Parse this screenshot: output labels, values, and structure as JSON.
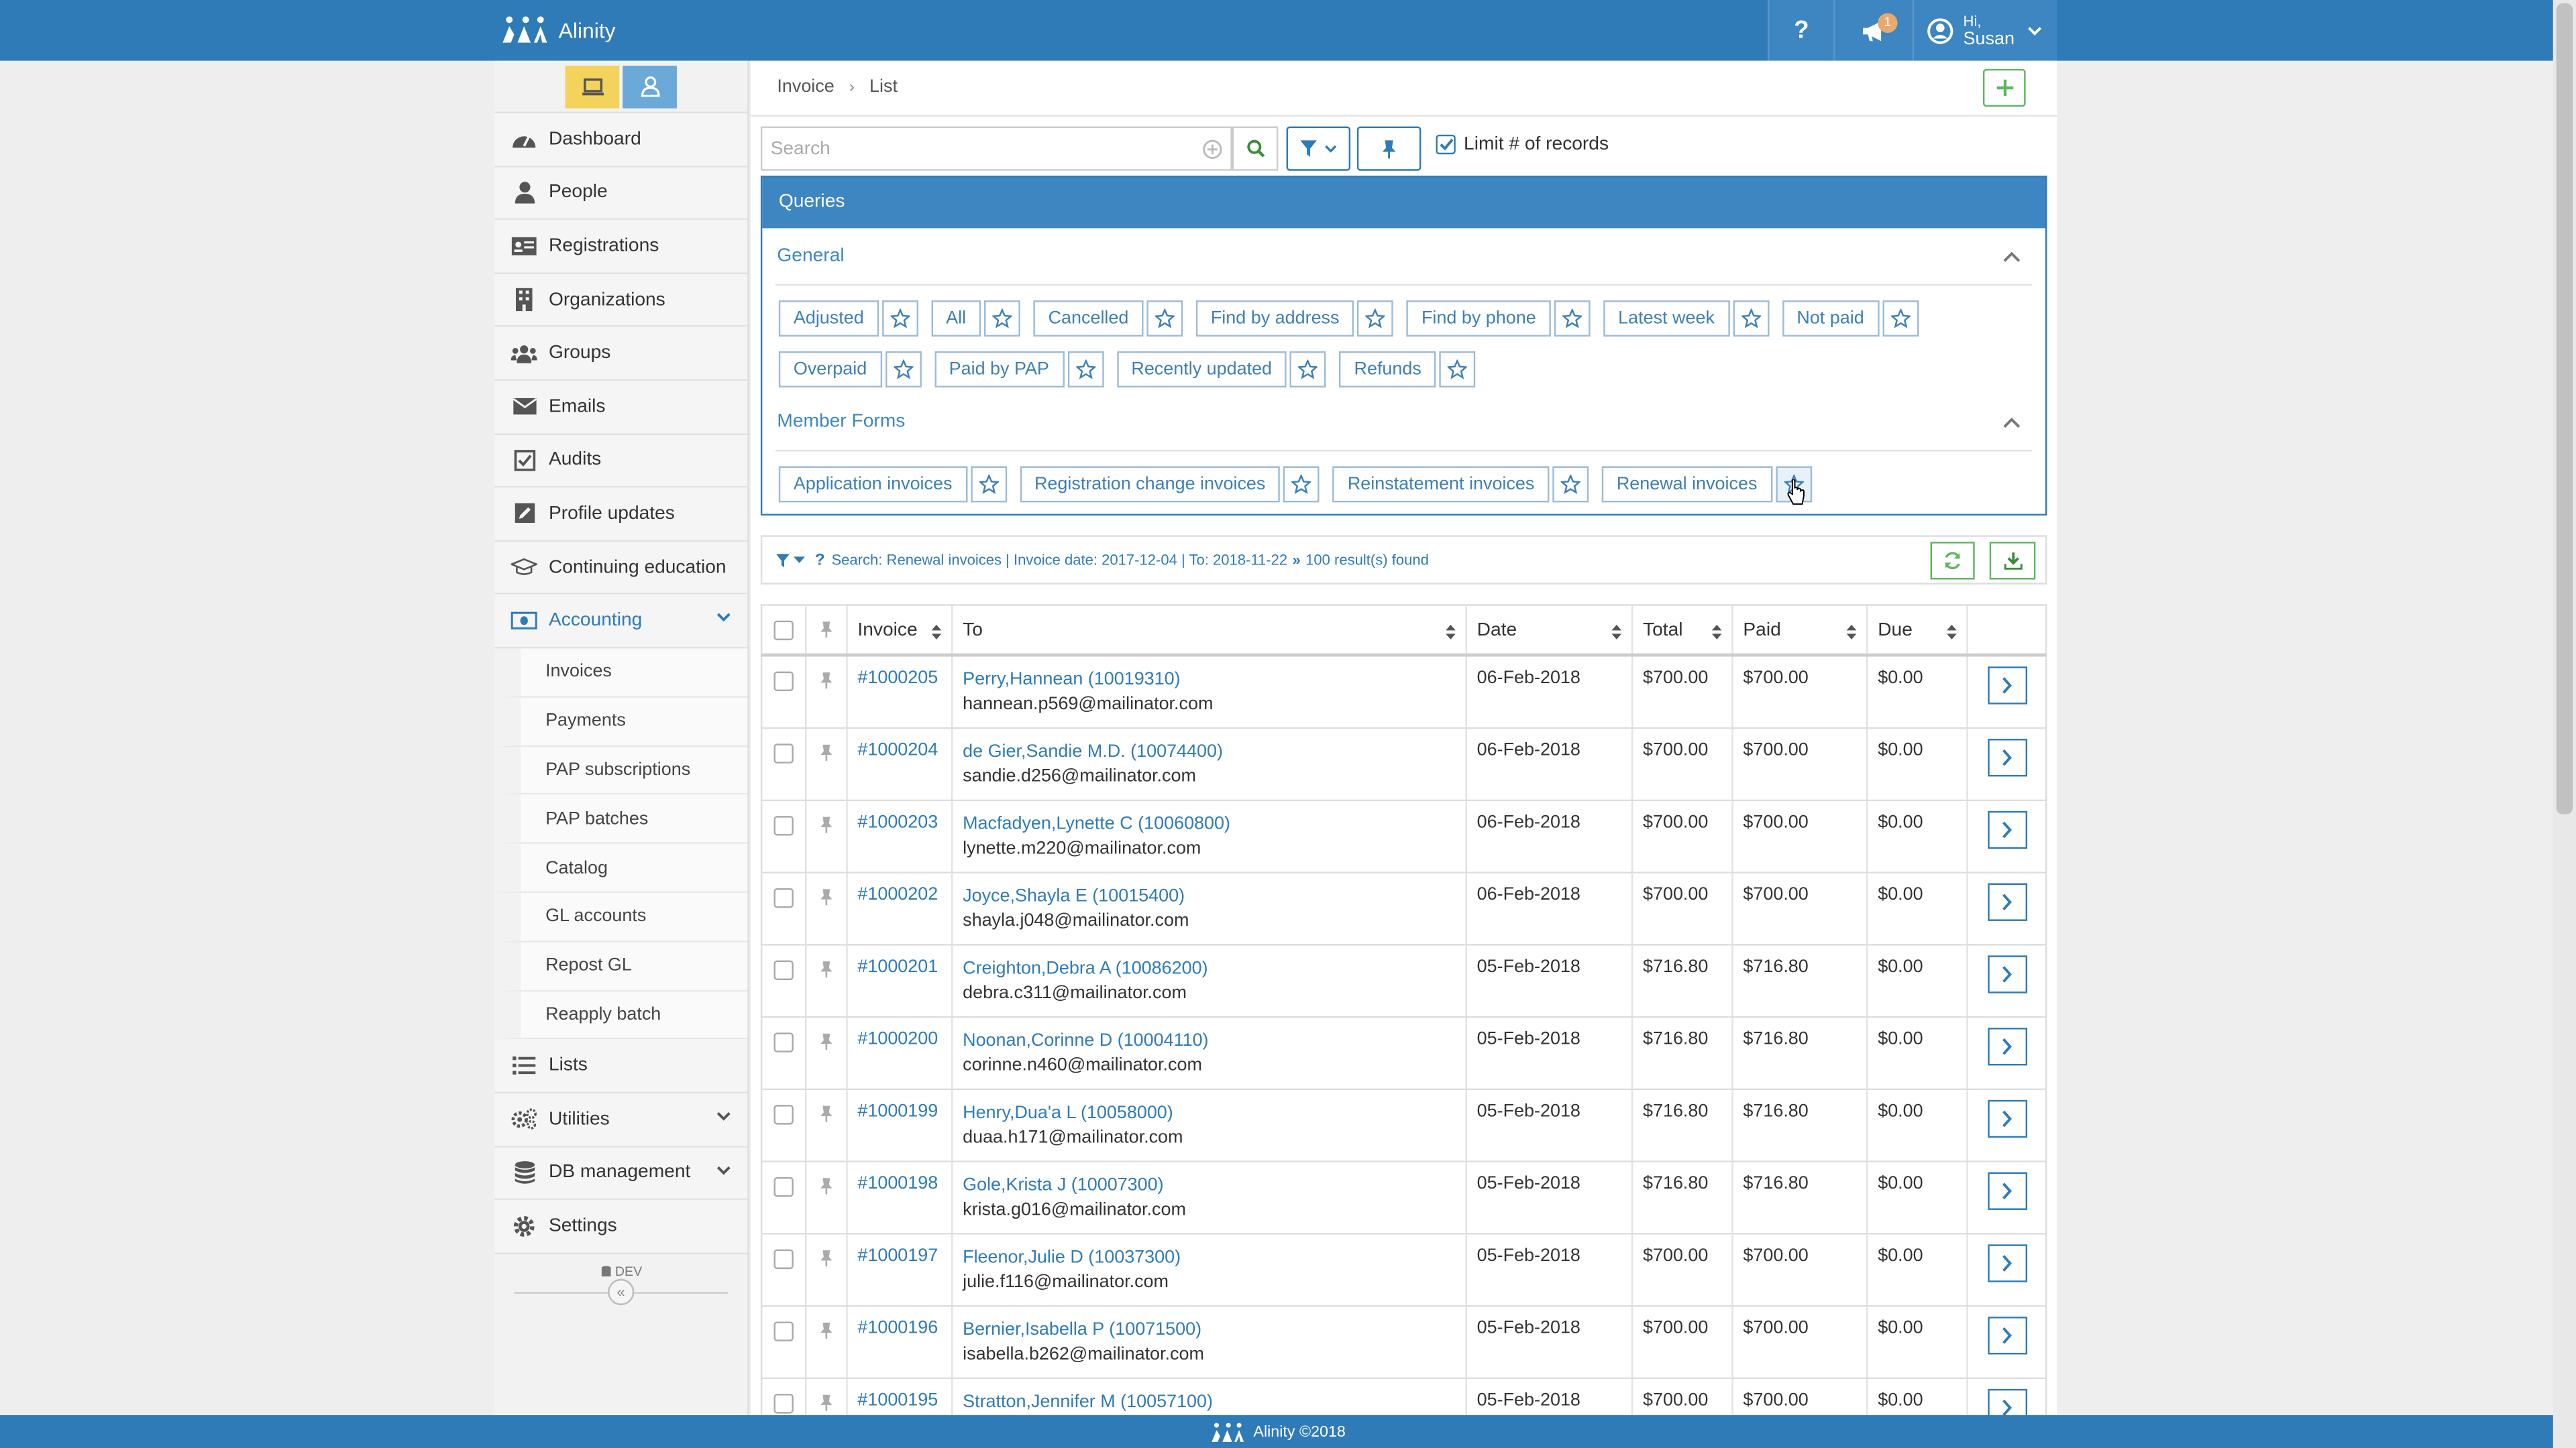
{
  "app": {
    "name": "Alinity"
  },
  "header": {
    "help_label": "?",
    "notifications_count": "1",
    "user_greeting": "Hi,",
    "user_name": "Susan"
  },
  "sidebar": {
    "items": [
      {
        "label": "Dashboard",
        "icon": "dashboard-icon"
      },
      {
        "label": "People",
        "icon": "person-icon"
      },
      {
        "label": "Registrations",
        "icon": "id-card-icon"
      },
      {
        "label": "Organizations",
        "icon": "building-icon"
      },
      {
        "label": "Groups",
        "icon": "users-icon"
      },
      {
        "label": "Emails",
        "icon": "envelope-icon"
      },
      {
        "label": "Audits",
        "icon": "checkbox-icon"
      },
      {
        "label": "Profile updates",
        "icon": "edit-icon"
      },
      {
        "label": "Continuing education",
        "icon": "graduation-cap-icon"
      },
      {
        "label": "Accounting",
        "icon": "money-icon",
        "active": true
      },
      {
        "label": "Lists",
        "icon": "list-icon"
      },
      {
        "label": "Utilities",
        "icon": "cogs-icon"
      },
      {
        "label": "DB management",
        "icon": "database-icon"
      },
      {
        "label": "Settings",
        "icon": "gear-icon"
      }
    ],
    "accounting_sub": [
      "Invoices",
      "Payments",
      "PAP subscriptions",
      "PAP batches",
      "Catalog",
      "GL accounts",
      "Repost GL",
      "Reapply batch"
    ],
    "env_label": "DEV",
    "collapse_label": "«"
  },
  "breadcrumb": {
    "root": "Invoice",
    "current": "List"
  },
  "search": {
    "placeholder": "Search",
    "value": ""
  },
  "limit": {
    "label": "Limit # of records",
    "checked": true
  },
  "queries": {
    "title": "Queries",
    "groups": [
      {
        "title": "General",
        "rows": [
          [
            "Adjusted",
            "All",
            "Cancelled",
            "Find by address",
            "Find by phone",
            "Latest week",
            "Not paid"
          ],
          [
            "Overpaid",
            "Paid by PAP",
            "Recently updated",
            "Refunds"
          ]
        ]
      },
      {
        "title": "Member Forms",
        "rows": [
          [
            "Application invoices",
            "Registration change invoices",
            "Reinstatement invoices",
            "Renewal invoices"
          ]
        ]
      }
    ]
  },
  "results": {
    "summary": "Search: Renewal invoices | Invoice date: 2017-12-04 | To: 2018-11-22",
    "count": "100 result(s) found"
  },
  "table": {
    "columns": [
      "Invoice",
      "To",
      "Date",
      "Total",
      "Paid",
      "Due"
    ],
    "rows": [
      {
        "invoice": "#1000205",
        "name": "Perry,Hannean (10019310)",
        "email": "hannean.p569@mailinator.com",
        "date": "06-Feb-2018",
        "total": "$700.00",
        "paid": "$700.00",
        "due": "$0.00"
      },
      {
        "invoice": "#1000204",
        "name": "de Gier,Sandie M.D. (10074400)",
        "email": "sandie.d256@mailinator.com",
        "date": "06-Feb-2018",
        "total": "$700.00",
        "paid": "$700.00",
        "due": "$0.00"
      },
      {
        "invoice": "#1000203",
        "name": "Macfadyen,Lynette C (10060800)",
        "email": "lynette.m220@mailinator.com",
        "date": "06-Feb-2018",
        "total": "$700.00",
        "paid": "$700.00",
        "due": "$0.00"
      },
      {
        "invoice": "#1000202",
        "name": "Joyce,Shayla E (10015400)",
        "email": "shayla.j048@mailinator.com",
        "date": "06-Feb-2018",
        "total": "$700.00",
        "paid": "$700.00",
        "due": "$0.00"
      },
      {
        "invoice": "#1000201",
        "name": "Creighton,Debra A (10086200)",
        "email": "debra.c311@mailinator.com",
        "date": "05-Feb-2018",
        "total": "$716.80",
        "paid": "$716.80",
        "due": "$0.00"
      },
      {
        "invoice": "#1000200",
        "name": "Noonan,Corinne D (10004110)",
        "email": "corinne.n460@mailinator.com",
        "date": "05-Feb-2018",
        "total": "$716.80",
        "paid": "$716.80",
        "due": "$0.00"
      },
      {
        "invoice": "#1000199",
        "name": "Henry,Dua'a L (10058000)",
        "email": "duaa.h171@mailinator.com",
        "date": "05-Feb-2018",
        "total": "$716.80",
        "paid": "$716.80",
        "due": "$0.00"
      },
      {
        "invoice": "#1000198",
        "name": "Gole,Krista J (10007300)",
        "email": "krista.g016@mailinator.com",
        "date": "05-Feb-2018",
        "total": "$716.80",
        "paid": "$716.80",
        "due": "$0.00"
      },
      {
        "invoice": "#1000197",
        "name": "Fleenor,Julie D (10037300)",
        "email": "julie.f116@mailinator.com",
        "date": "05-Feb-2018",
        "total": "$700.00",
        "paid": "$700.00",
        "due": "$0.00"
      },
      {
        "invoice": "#1000196",
        "name": "Bernier,Isabella P (10071500)",
        "email": "isabella.b262@mailinator.com",
        "date": "05-Feb-2018",
        "total": "$700.00",
        "paid": "$700.00",
        "due": "$0.00"
      },
      {
        "invoice": "#1000195",
        "name": "Stratton,Jennifer M (10057100)",
        "email": "",
        "date": "05-Feb-2018",
        "total": "$700.00",
        "paid": "$700.00",
        "due": "$0.00"
      }
    ]
  },
  "footer": {
    "text": "Alinity ©2018"
  },
  "colors": {
    "primary": "#2e7bb8",
    "success": "#5cb85c",
    "mode_desktop": "#f3d35c",
    "mode_person": "#6ba9d9"
  }
}
